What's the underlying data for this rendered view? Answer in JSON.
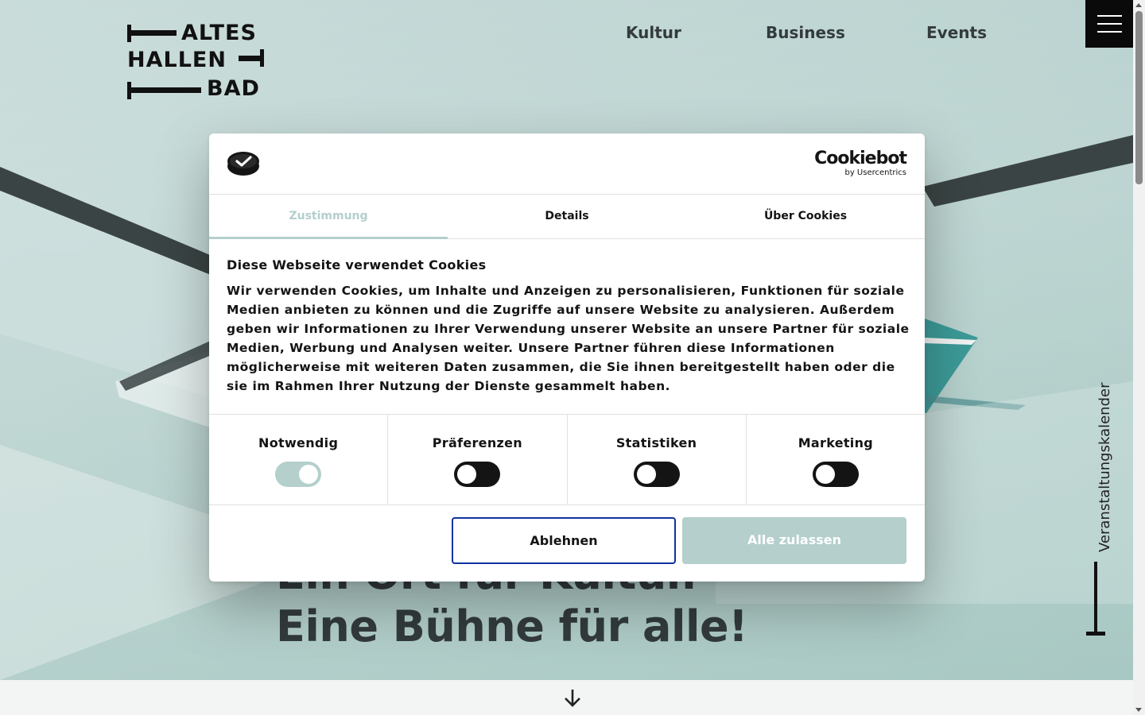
{
  "site": {
    "logo": {
      "line1": "ALTES",
      "line2": "HALLEN",
      "line3": "BAD"
    },
    "nav": [
      {
        "label": "Kultur"
      },
      {
        "label": "Business"
      },
      {
        "label": "Events"
      }
    ],
    "hero": {
      "line1": "Ein Ort für Kultur.",
      "line2": "Eine Bühne für alle!"
    },
    "side_calendar_label": "Veranstaltungskalender",
    "colors": {
      "accent": "#b4cfcc",
      "text_dark": "#333b3d",
      "menu_bg": "#0a0a0a",
      "decline_border": "#1032a0"
    }
  },
  "cookie_dialog": {
    "brand_name": "Cookiebot",
    "brand_by": "by Usercentrics",
    "tabs": [
      {
        "label": "Zustimmung",
        "active": true
      },
      {
        "label": "Details",
        "active": false
      },
      {
        "label": "Über Cookies",
        "active": false
      }
    ],
    "heading": "Diese Webseite verwendet Cookies",
    "body": "Wir verwenden Cookies, um Inhalte und Anzeigen zu personalisieren, Funktionen für soziale Medien anbieten zu können und die Zugriffe auf unsere Website zu analysieren. Außerdem geben wir Informationen zu Ihrer Verwendung unserer Website an unsere Partner für soziale Medien, Werbung und Analysen weiter. Unsere Partner führen diese Informationen möglicherweise mit weiteren Daten zusammen, die Sie ihnen bereitgestellt haben oder die sie im Rahmen Ihrer Nutzung der Dienste gesammelt haben.",
    "categories": [
      {
        "label": "Notwendig",
        "checked": true
      },
      {
        "label": "Präferenzen",
        "checked": false
      },
      {
        "label": "Statistiken",
        "checked": false
      },
      {
        "label": "Marketing",
        "checked": false
      }
    ],
    "decline_label": "Ablehnen",
    "accept_label": "Alle zulassen"
  }
}
